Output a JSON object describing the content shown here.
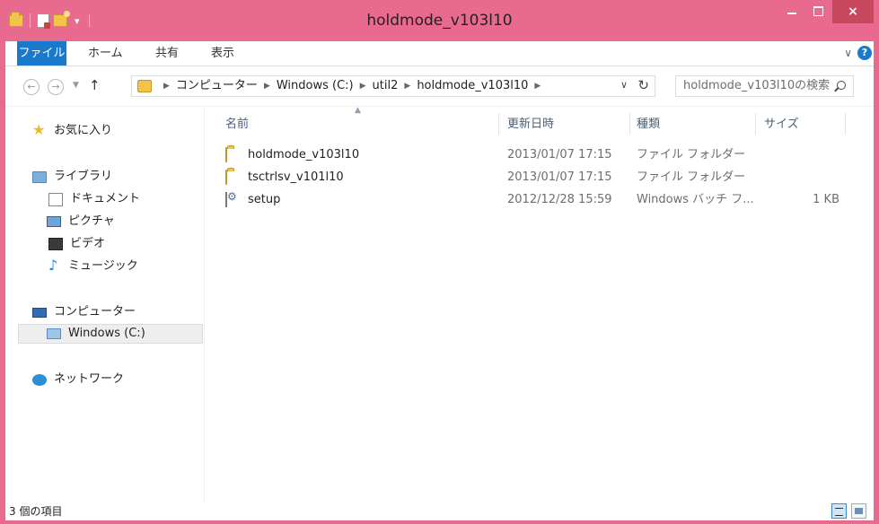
{
  "window": {
    "title": "holdmode_v103l10",
    "close_glyph": "×"
  },
  "ribbon": {
    "tabs": [
      "ファイル",
      "ホーム",
      "共有",
      "表示"
    ]
  },
  "address": {
    "crumbs": [
      "コンピューター",
      "Windows (C:)",
      "util2",
      "holdmode_v103l10"
    ]
  },
  "search": {
    "placeholder": "holdmode_v103l10の検索"
  },
  "navpane": {
    "favorites": "お気に入り",
    "libraries": "ライブラリ",
    "documents": "ドキュメント",
    "pictures": "ピクチャ",
    "videos": "ビデオ",
    "music": "ミュージック",
    "computer": "コンピューター",
    "drive": "Windows (C:)",
    "network": "ネットワーク"
  },
  "columns": {
    "name": "名前",
    "date": "更新日時",
    "type": "種類",
    "size": "サイズ"
  },
  "files": [
    {
      "name": "holdmode_v103l10",
      "date": "2013/01/07 17:15",
      "type": "ファイル フォルダー",
      "size": "",
      "icon": "folder"
    },
    {
      "name": "tsctrlsv_v101l10",
      "date": "2013/01/07 17:15",
      "type": "ファイル フォルダー",
      "size": "",
      "icon": "folder"
    },
    {
      "name": "setup",
      "date": "2012/12/28 15:59",
      "type": "Windows バッチ フ...",
      "size": "1 KB",
      "icon": "batch-file"
    }
  ],
  "status": {
    "text": "3 個の項目"
  },
  "colors": {
    "frame": "#e96a8f",
    "file_tab": "#1979ca"
  }
}
